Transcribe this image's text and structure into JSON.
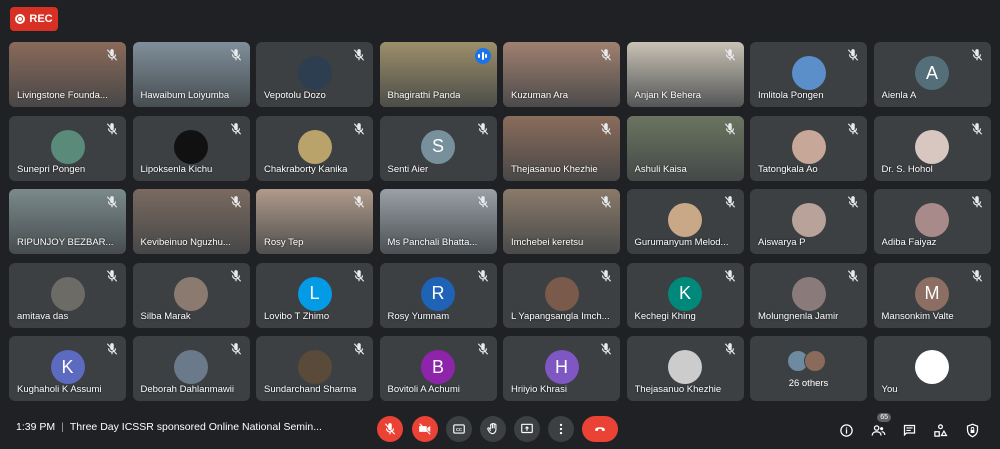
{
  "recording": {
    "label": "REC"
  },
  "participants": [
    {
      "name": "Livingstone Founda...",
      "type": "video",
      "bg": "#8a6a5a"
    },
    {
      "name": "Hawaibum Loiyumba",
      "type": "video",
      "bg": "#7f8f9a"
    },
    {
      "name": "Vepotolu Dozo",
      "type": "photo",
      "bg": "#2c3e50"
    },
    {
      "name": "Bhagirathi Panda",
      "type": "video",
      "bg": "#9c8f6a",
      "speaking": true
    },
    {
      "name": "Kuzuman Ara",
      "type": "video",
      "bg": "#a08070"
    },
    {
      "name": "Anjan K Behera",
      "type": "video",
      "bg": "#c9c2b5"
    },
    {
      "name": "Imlitola Pongen",
      "type": "photo",
      "bg": "#5b8fc9"
    },
    {
      "name": "Aienla A",
      "type": "initial",
      "initial": "A",
      "color": "#546e7a"
    },
    {
      "name": "Sunepri Pongen",
      "type": "photo",
      "bg": "#5a8a7a"
    },
    {
      "name": "Lipoksenla Kichu",
      "type": "photo",
      "bg": "#111111"
    },
    {
      "name": "Chakraborty Kanika",
      "type": "photo",
      "bg": "#b9a36a"
    },
    {
      "name": "Senti Aier",
      "type": "initial",
      "initial": "S",
      "color": "#78909c"
    },
    {
      "name": "Thejasanuo Khezhie",
      "type": "video",
      "bg": "#8a6d5c"
    },
    {
      "name": "Ashuli Kaisa",
      "type": "video",
      "bg": "#6b7460"
    },
    {
      "name": "Tatongkala Ao",
      "type": "photo",
      "bg": "#c7a898"
    },
    {
      "name": "Dr. S. Hohol",
      "type": "photo",
      "bg": "#d8c7c0"
    },
    {
      "name": "RIPUNJOY BEZBAR...",
      "type": "video",
      "bg": "#7b8a8a"
    },
    {
      "name": "Kevibeinuo Nguzhu...",
      "type": "video",
      "bg": "#7a6a60"
    },
    {
      "name": "Rosy Tep",
      "type": "video",
      "bg": "#b09a8a"
    },
    {
      "name": "Ms Panchali Bhatta...",
      "type": "video",
      "bg": "#9aa0a6"
    },
    {
      "name": "Imchebei keretsu",
      "type": "video",
      "bg": "#8a7a6a"
    },
    {
      "name": "Gurumanyum Melod...",
      "type": "photo",
      "bg": "#c9a888"
    },
    {
      "name": "Aiswarya P",
      "type": "photo",
      "bg": "#b8a29a"
    },
    {
      "name": "Adiba Faiyaz",
      "type": "photo",
      "bg": "#a88a8a"
    },
    {
      "name": "amitava das",
      "type": "photo",
      "bg": "#6d6b66"
    },
    {
      "name": "Silba Marak",
      "type": "photo",
      "bg": "#8a7a70"
    },
    {
      "name": "Lovibo T Zhimo",
      "type": "initial",
      "initial": "L",
      "color": "#039be5"
    },
    {
      "name": "Rosy Yumnam",
      "type": "initial",
      "initial": "R",
      "color": "#1e63b5"
    },
    {
      "name": "L Yapangsangla Imch...",
      "type": "photo",
      "bg": "#7a5a4a"
    },
    {
      "name": "Kechegi Khing",
      "type": "initial",
      "initial": "K",
      "color": "#00897b"
    },
    {
      "name": "Molungnenla Jamir",
      "type": "photo",
      "bg": "#8a7a7a"
    },
    {
      "name": "Mansonkim Valte",
      "type": "initial",
      "initial": "M",
      "color": "#8d6e63"
    },
    {
      "name": "Kughaholi K Assumi",
      "type": "initial",
      "initial": "K",
      "color": "#5c6bc0"
    },
    {
      "name": "Deborah Dahlanmawii",
      "type": "photo",
      "bg": "#6a7a8a"
    },
    {
      "name": "Sundarchand Sharma",
      "type": "photo",
      "bg": "#5a4a3a"
    },
    {
      "name": "Bovitoli A Achumi",
      "type": "initial",
      "initial": "B",
      "color": "#8e24aa"
    },
    {
      "name": "Hriiyio Khrasi",
      "type": "initial",
      "initial": "H",
      "color": "#7e57c2"
    },
    {
      "name": "Thejasanuo Khezhie",
      "type": "photo",
      "bg": "#cccccc"
    },
    {
      "name": "",
      "type": "others",
      "label": "26 others"
    },
    {
      "name": "You",
      "type": "photo",
      "bg": "#ffffff",
      "self": true
    }
  ],
  "bottom": {
    "time": "1:39 PM",
    "meeting_title": "Three Day ICSSR sponsored Online National Semin...",
    "participant_count": "65"
  },
  "colors": {
    "accent": "#8ab4f8",
    "danger": "#ea4335",
    "tile": "#3c4043",
    "bg": "#202124"
  }
}
